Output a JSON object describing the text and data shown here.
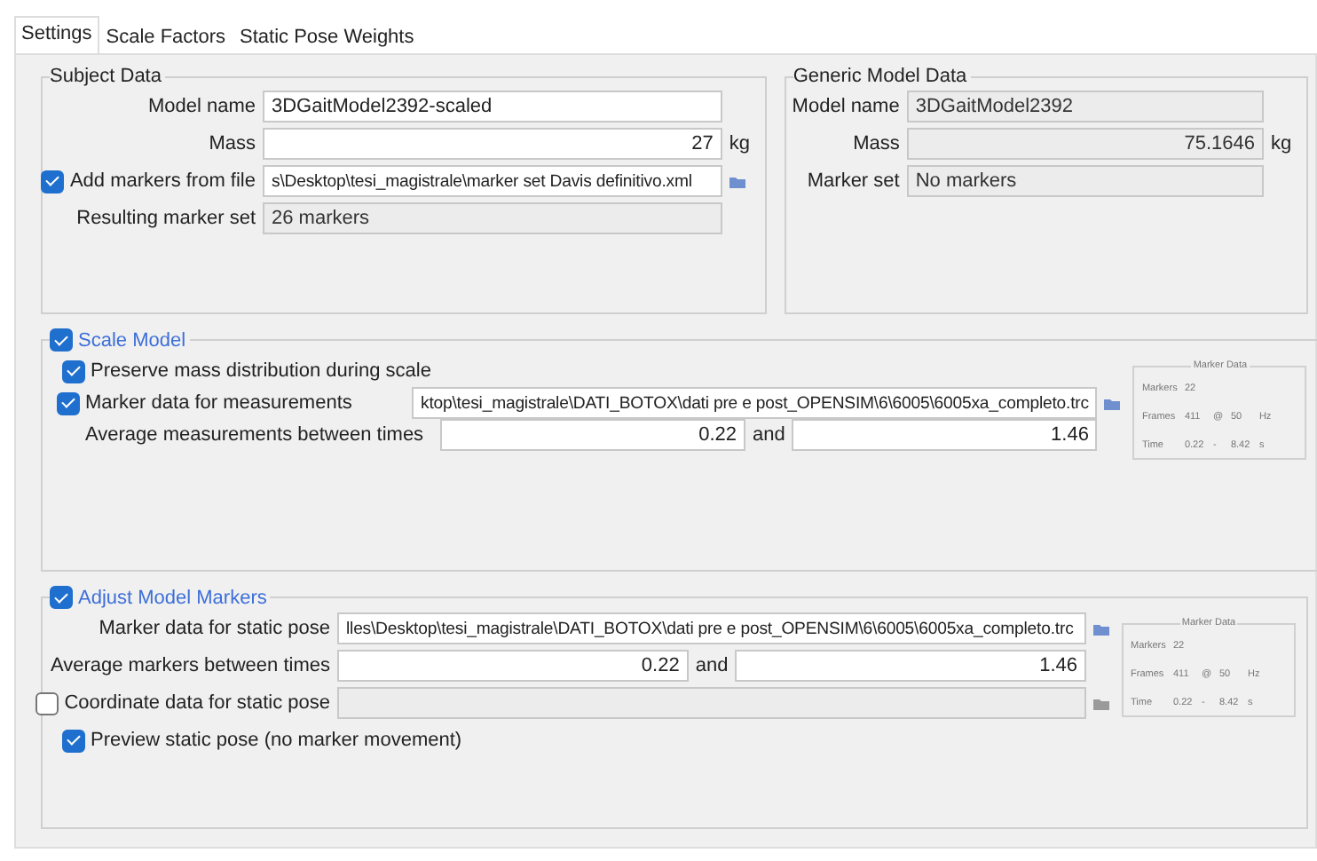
{
  "tabs": [
    {
      "label": "Settings",
      "selected": true
    },
    {
      "label": "Scale Factors",
      "selected": false
    },
    {
      "label": "Static Pose Weights",
      "selected": false
    }
  ],
  "subject_data": {
    "title": "Subject Data",
    "rows": [
      {
        "kind": "field",
        "label": "Model name",
        "value": "3DGaitModel2392-scaled"
      },
      {
        "kind": "number",
        "label": "Mass",
        "value": "27",
        "unit": "kg"
      },
      {
        "kind": "file",
        "label": "Add markers from file",
        "checked": true,
        "value": "s\\Desktop\\tesi_magistrale\\marker set Davis definitivo.xml"
      },
      {
        "kind": "readonly",
        "label": "Resulting marker set",
        "value": "26 markers"
      }
    ]
  },
  "generic_model_data": {
    "title": "Generic Model Data",
    "rows": [
      {
        "kind": "readonly",
        "label": "Model name",
        "value": "3DGaitModel2392"
      },
      {
        "kind": "readonly_number",
        "label": "Mass",
        "value": "75.1646",
        "unit": "kg"
      },
      {
        "kind": "readonly",
        "label": "Marker set",
        "value": "No markers"
      }
    ]
  },
  "scale_model": {
    "title": "Scale Model",
    "checked": true,
    "rows": [
      {
        "kind": "check",
        "label": "Preserve mass distribution during scale",
        "checked": true
      },
      {
        "kind": "file",
        "label": "Marker data for measurements",
        "checked": true,
        "value": "ktop\\tesi_magistrale\\DATI_BOTOX\\dati pre e post_OPENSIM\\6\\6005\\6005xa_completo.trc"
      },
      {
        "kind": "range",
        "label": "Average measurements between times",
        "from": "0.22",
        "joiner": "and",
        "to": "1.46"
      }
    ],
    "marker_data": {
      "title": "Marker Data",
      "rows": [
        {
          "label": "Markers",
          "values": [
            "22"
          ]
        },
        {
          "label": "Frames",
          "values": [
            "411",
            "@",
            "50",
            "Hz"
          ]
        },
        {
          "label": "Time",
          "values": [
            "0.22",
            "-",
            "8.42",
            "s"
          ]
        }
      ]
    }
  },
  "adjust_model_markers": {
    "title": "Adjust Model Markers",
    "checked": true,
    "rows": [
      {
        "kind": "file",
        "label": "Marker data for static pose",
        "value": "lles\\Desktop\\tesi_magistrale\\DATI_BOTOX\\dati pre e post_OPENSIM\\6\\6005\\6005xa_completo.trc"
      },
      {
        "kind": "range",
        "label": "Average markers between times",
        "from": "0.22",
        "joiner": "and",
        "to": "1.46"
      },
      {
        "kind": "file",
        "label": "Coordinate data for static pose",
        "checked": false
      },
      {
        "kind": "check",
        "label": "Preview static pose (no marker movement)",
        "checked": true
      }
    ],
    "marker_data": {
      "title": "Marker Data",
      "rows": [
        {
          "label": "Markers",
          "values": [
            "22"
          ]
        },
        {
          "label": "Frames",
          "values": [
            "411",
            "@",
            "50",
            "Hz"
          ]
        },
        {
          "label": "Time",
          "values": [
            "0.22",
            "-",
            "8.42",
            "s"
          ]
        }
      ]
    }
  }
}
